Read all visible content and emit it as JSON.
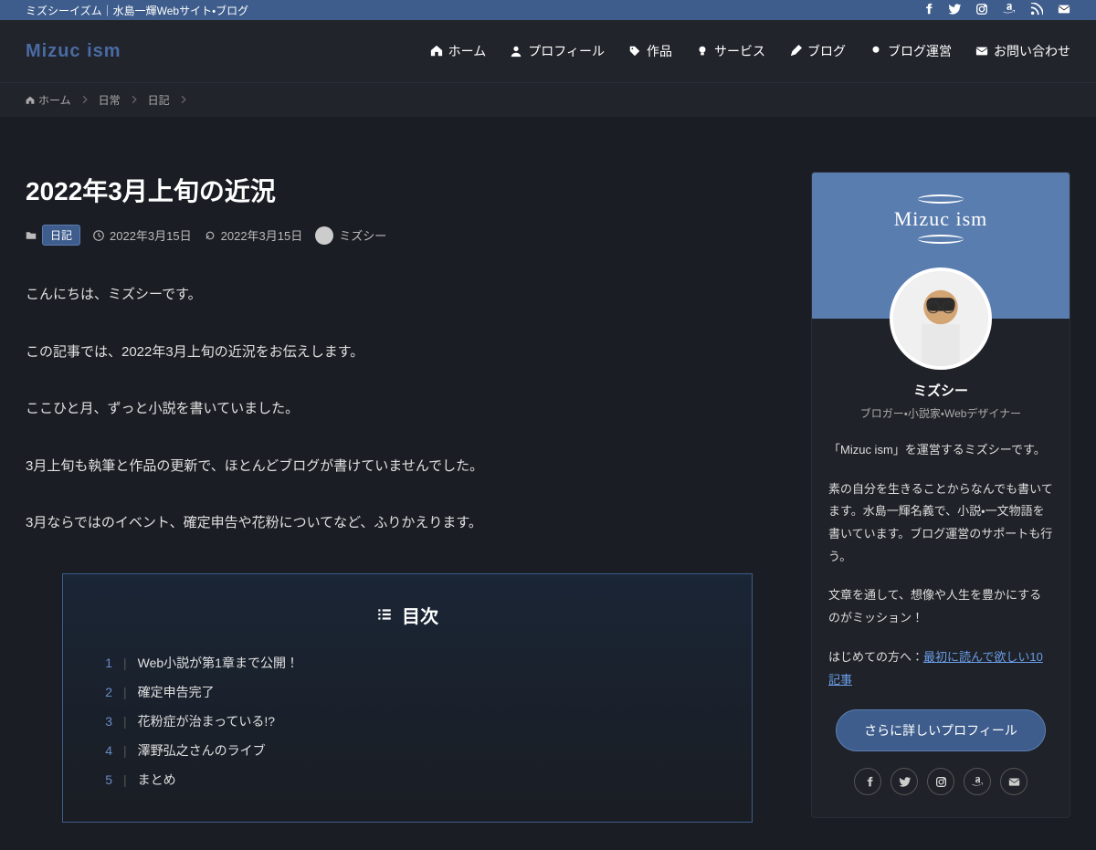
{
  "site": {
    "tagline": "ミズシーイズム｜水島一輝Webサイト・ブログ",
    "logo": "Mizuc ism"
  },
  "nav": [
    {
      "icon": "home",
      "label": "ホーム"
    },
    {
      "icon": "user",
      "label": "プロフィール"
    },
    {
      "icon": "tag",
      "label": "作品"
    },
    {
      "icon": "bulb",
      "label": "サービス"
    },
    {
      "icon": "pen",
      "label": "ブログ"
    },
    {
      "icon": "pin",
      "label": "ブログ運営"
    },
    {
      "icon": "mail",
      "label": "お問い合わせ"
    }
  ],
  "breadcrumb": [
    {
      "label": "ホーム",
      "icon": "home"
    },
    {
      "label": "日常"
    },
    {
      "label": "日記"
    }
  ],
  "article": {
    "title": "2022年3月上旬の近況",
    "category": "日記",
    "published": "2022年3月15日",
    "updated": "2022年3月15日",
    "author": "ミズシー",
    "paragraphs": [
      "こんにちは、ミズシーです。",
      "この記事では、2022年3月上旬の近況をお伝えします。",
      "ここひと月、ずっと小説を書いていました。",
      "3月上旬も執筆と作品の更新で、ほとんどブログが書けていませんでした。",
      "3月ならではのイベント、確定申告や花粉についてなど、ふりかえります。"
    ]
  },
  "toc": {
    "title": "目次",
    "items": [
      "Web小説が第1章まで公開！",
      "確定申告完了",
      "花粉症が治まっている!?",
      "澤野弘之さんのライブ",
      "まとめ"
    ]
  },
  "profile": {
    "header_text": "Mizuc ism",
    "name": "ミズシー",
    "role": "ブロガー・小説家・Webデザイナー",
    "desc1": "「Mizuc ism」を運営するミズシーです。",
    "desc2": "素の自分を生きることからなんでも書いてます。水島一輝名義で、小説・一文物語を書いています。ブログ運営のサポートも行う。",
    "desc3": "文章を通して、想像や人生を豊かにするのがミッション！",
    "intro_prefix": "はじめての方へ：",
    "intro_link": "最初に読んで欲しい10記事",
    "button": "さらに詳しいプロフィール"
  }
}
